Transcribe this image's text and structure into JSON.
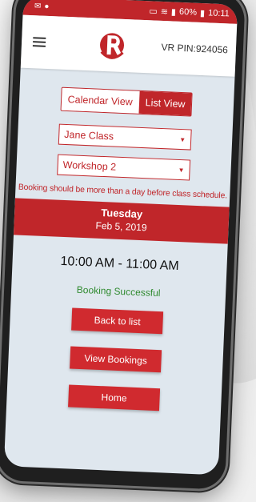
{
  "statusbar": {
    "battery": "60%",
    "time": "10:11"
  },
  "header": {
    "vr_pin": "VR PIN:924056"
  },
  "view_toggle": {
    "calendar_label": "Calendar View",
    "list_label": "List View",
    "selected": "List View"
  },
  "filters": {
    "class_value": "Jane Class",
    "workshop_value": "Workshop 2"
  },
  "warning": "Booking should be more than a day before class schedule.",
  "schedule": {
    "day": "Tuesday",
    "date": "Feb 5, 2019",
    "time_range": "10:00 AM - 11:00 AM",
    "status": "Booking Successful"
  },
  "actions": {
    "back_label": "Back to list",
    "view_bookings_label": "View Bookings",
    "home_label": "Home"
  },
  "colors": {
    "brand_red": "#c0262a",
    "success_green": "#2f8a2f",
    "screen_bg": "#dfe7ee"
  }
}
